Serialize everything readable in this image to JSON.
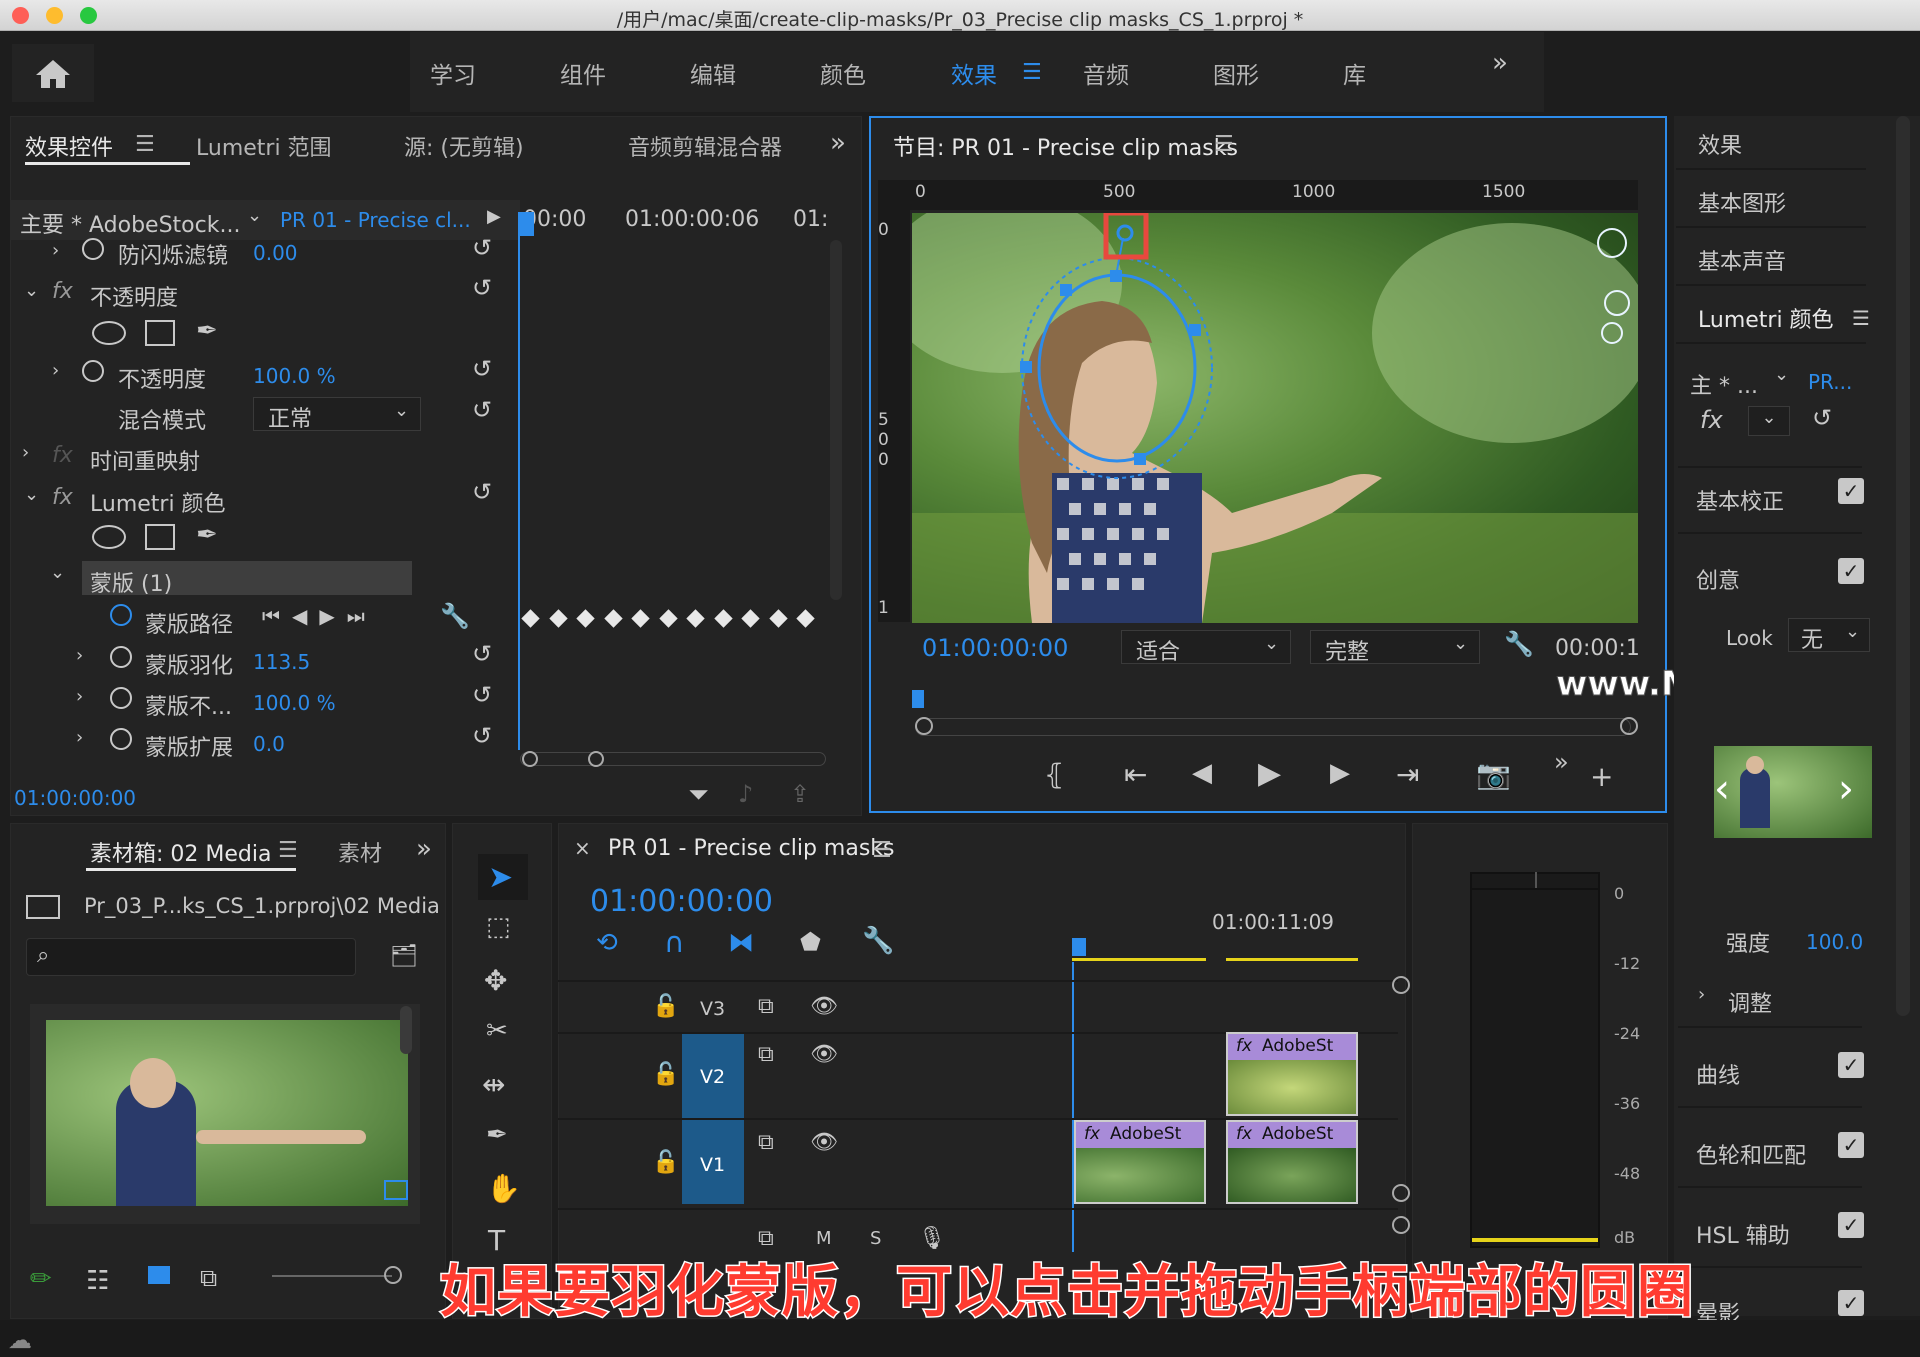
{
  "window": {
    "title": "/用户/mac/桌面/create-clip-masks/Pr_03_Precise clip masks_CS_1.prproj *"
  },
  "workspaces": [
    "学习",
    "组件",
    "编辑",
    "颜色",
    "效果",
    "音频",
    "图形",
    "库"
  ],
  "workspace_active": "效果",
  "effect_controls": {
    "tabs": [
      "效果控件",
      "Lumetri 范围",
      "源: (无剪辑)",
      "音频剪辑混合器"
    ],
    "source_label": "主要 * AdobeStock...",
    "sequence_label": "PR 01 - Precise cl...",
    "tc_start": "00:00",
    "tc_mid": "01:00:00:06",
    "tc_end": "01:",
    "rows": {
      "antiflicker": {
        "label": "防闪烁滤镜",
        "value": "0.00"
      },
      "opacity_group": "不透明度",
      "opacity": {
        "label": "不透明度",
        "value": "100.0 %"
      },
      "blend": {
        "label": "混合模式",
        "value": "正常"
      },
      "time_remap": "时间重映射",
      "lumetri": "Lumetri 颜色",
      "mask": "蒙版 (1)",
      "mask_path": "蒙版路径",
      "mask_feather": {
        "label": "蒙版羽化",
        "value": "113.5"
      },
      "mask_opacity": {
        "label": "蒙版不...",
        "value": "100.0 %"
      },
      "mask_expansion": {
        "label": "蒙版扩展",
        "value": "0.0"
      }
    },
    "timecode": "01:00:00:00",
    "keyframe_count": 11
  },
  "program": {
    "title": "节目: PR 01 - Precise clip masks",
    "ruler": [
      "0",
      "500",
      "1000",
      "1500"
    ],
    "vruler": [
      "0",
      "5",
      "0",
      "0",
      "1"
    ],
    "timecode": "01:00:00:00",
    "fit": "适合",
    "quality": "完整",
    "tc_right": "00:00:1"
  },
  "watermark": "www.MacZ.com",
  "effects_panel": {
    "tabs": [
      "效果",
      "基本图形",
      "基本声音",
      "Lumetri 颜色"
    ],
    "source": "主 * ...",
    "seq": "PR...",
    "sections": [
      {
        "label": "基本校正",
        "checked": true
      },
      {
        "label": "创意",
        "checked": true
      }
    ],
    "look_label": "Look",
    "look_value": "无",
    "strength_label": "强度",
    "strength_value": "100.0",
    "adjust": "调整",
    "sections2": [
      {
        "label": "曲线",
        "checked": true
      },
      {
        "label": "色轮和匹配",
        "checked": true
      },
      {
        "label": "HSL 辅助",
        "checked": true
      },
      {
        "label": "晕影",
        "checked": true
      }
    ]
  },
  "bin": {
    "tab": "素材箱: 02 Media",
    "tab2": "素材",
    "path": "Pr_03_P...ks_CS_1.prproj\\02 Media"
  },
  "timeline": {
    "title": "PR 01 - Precise clip masks",
    "timecode": "01:00:00:00",
    "marker_tc": "01:00:11:09",
    "tracks": [
      "V3",
      "V2",
      "V1"
    ],
    "clips": [
      {
        "name": "AdobeSt",
        "track": "V2"
      },
      {
        "name": "AdobeSt",
        "track": "V1"
      },
      {
        "name": "AdobeSt",
        "track": "V1"
      }
    ],
    "audio_m": "M",
    "audio_s": "S"
  },
  "meter": {
    "labels": [
      "0",
      "-12",
      "-24",
      "-36",
      "-48",
      "dB"
    ]
  },
  "caption": "如果要羽化蒙版，可以点击并拖动手柄端部的圆圈",
  "colors": {
    "accent": "#2d8ceb",
    "caption": "#ff3b30",
    "highlight": "#e8483e",
    "clip": "#a88bd8"
  }
}
